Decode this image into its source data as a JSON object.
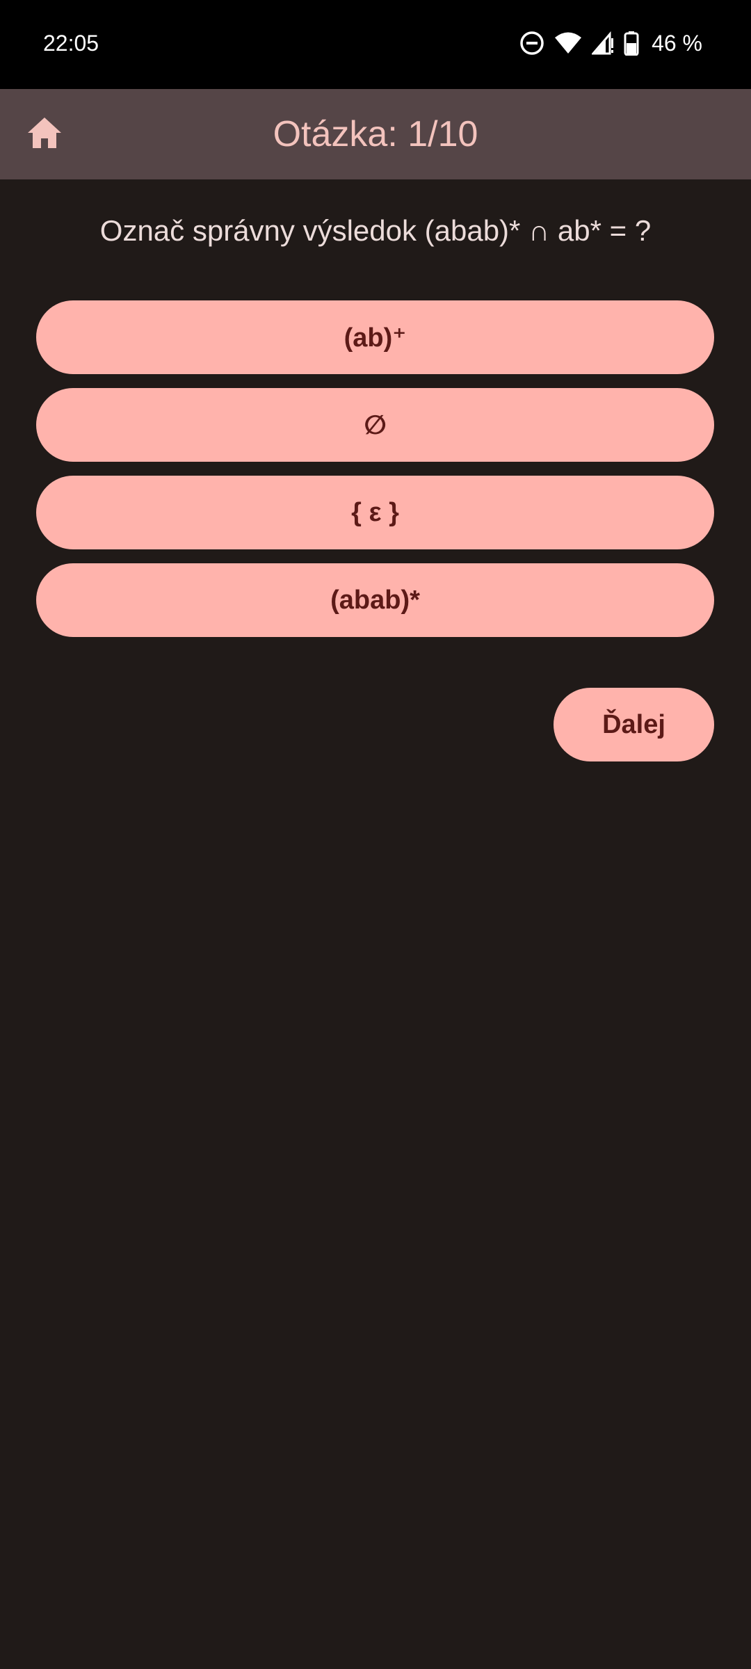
{
  "status_bar": {
    "time": "22:05",
    "battery": "46 %",
    "icons": [
      "do-not-disturb-icon",
      "wifi-icon",
      "cell-signal-icon",
      "battery-icon"
    ]
  },
  "header": {
    "title": "Otázka: 1/10",
    "home_icon": "home-icon"
  },
  "question": {
    "text": "Označ správny výsledok (abab)* ∩ ab* = ?"
  },
  "answers": [
    {
      "label": "(ab)⁺"
    },
    {
      "label": "∅"
    },
    {
      "label": "{ ε }"
    },
    {
      "label": "(abab)*"
    }
  ],
  "next_button": {
    "label": "Ďalej"
  },
  "colors": {
    "background": "#201a18",
    "top_bar": "#554547",
    "title_text": "#f3c3bd",
    "button_bg": "#ffb3ac",
    "button_text": "#5c1a17"
  }
}
